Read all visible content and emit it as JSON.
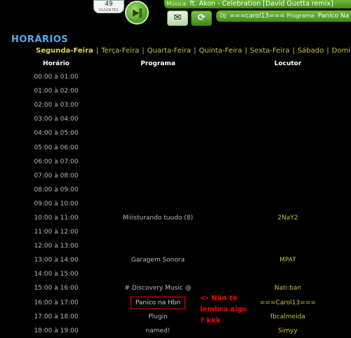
{
  "player": {
    "listeners_count": "49",
    "listeners_label": "OUVINTES",
    "song_key": "Música:",
    "song_title": "ft. Akon - Celebration [David Guetta remix]",
    "dj_key": "DJ:",
    "dj_name": "===carol13===",
    "program_key": "Programa:",
    "program_name": "Panico Na Hbn"
  },
  "page": {
    "title": "HORÁRIOS"
  },
  "days": [
    {
      "label": "Segunda-Feira",
      "active": true
    },
    {
      "label": "Terça-Feira"
    },
    {
      "label": "Quarta-Feira"
    },
    {
      "label": "Quinta-Feira"
    },
    {
      "label": "Sexta-Feira"
    },
    {
      "label": "Sábado"
    },
    {
      "label": "Domingo"
    }
  ],
  "table": {
    "headers": {
      "time": "Horário",
      "program": "Programa",
      "host": "Locutor"
    },
    "rows": [
      {
        "time": "00:00 à 01:00",
        "program": "",
        "host": ""
      },
      {
        "time": "01:00 à 02:00",
        "program": "",
        "host": ""
      },
      {
        "time": "02:00 à 03:00",
        "program": "",
        "host": ""
      },
      {
        "time": "03:00 à 04:00",
        "program": "",
        "host": ""
      },
      {
        "time": "04:00 à 05:00",
        "program": "",
        "host": ""
      },
      {
        "time": "05:00 à 06:00",
        "program": "",
        "host": ""
      },
      {
        "time": "06:00 à 07:00",
        "program": "",
        "host": ""
      },
      {
        "time": "07:00 à 08:00",
        "program": "",
        "host": ""
      },
      {
        "time": "08:00 à 09:00",
        "program": "",
        "host": ""
      },
      {
        "time": "09:00 à 10:00",
        "program": "",
        "host": ""
      },
      {
        "time": "10:00 à 11:00",
        "program": "Miiisturando tuudo (8)",
        "host": "2NaY2"
      },
      {
        "time": "11:00 à 12:00",
        "program": "",
        "host": ""
      },
      {
        "time": "12:00 à 13:00",
        "program": "",
        "host": ""
      },
      {
        "time": "13:00 à 14:00",
        "program": "Garagem Sonora",
        "host": "MPAT"
      },
      {
        "time": "14:00 à 15:00",
        "program": "",
        "host": ""
      },
      {
        "time": "15:00 à 16:00",
        "program": "# Discovery Music @",
        "host": "Nati:ban"
      },
      {
        "time": "16:00 à 17:00",
        "program": "Panico na Hbn",
        "host": "===Carol13===",
        "highlight": true
      },
      {
        "time": "17:00 à 18:00",
        "program": "Plugin",
        "host": "fbcalmeida"
      },
      {
        "time": "18:00 à 19:00",
        "program": "named!",
        "host": "Simyy"
      }
    ]
  },
  "annotation": {
    "text": "<- Não te lembra algo ? kkk",
    "color": "#ff0000"
  },
  "icons": {
    "play": "play-pause-icon",
    "mail": "envelope-icon",
    "refresh": "refresh-icon"
  }
}
